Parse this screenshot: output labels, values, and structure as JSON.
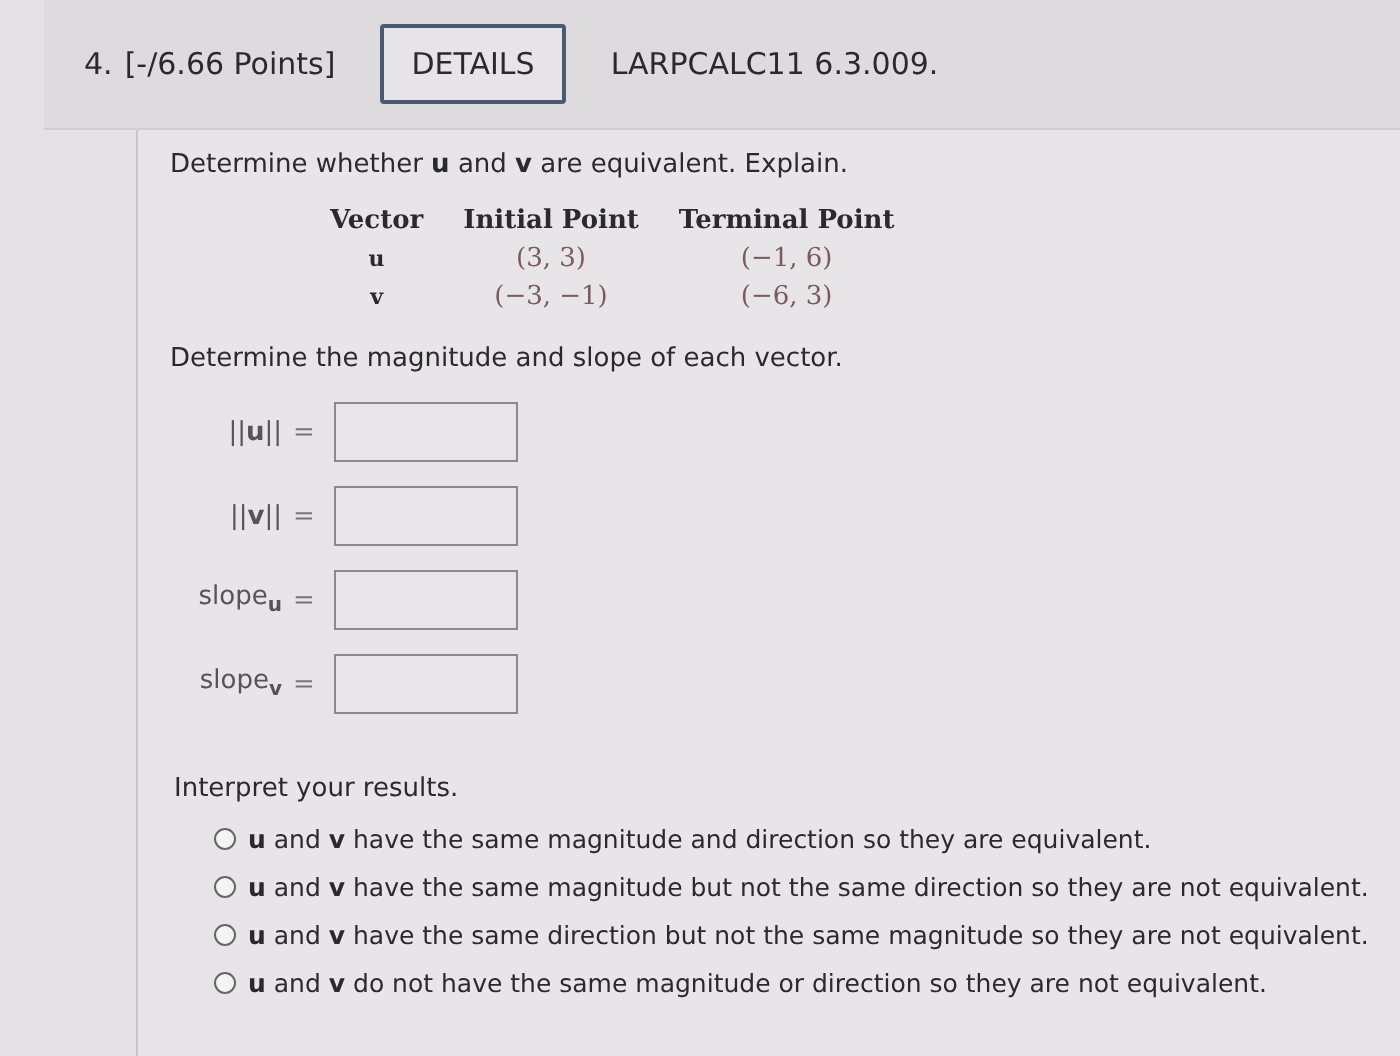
{
  "header": {
    "number": "4.",
    "points": "[-/6.66 Points]",
    "details_button": "DETAILS",
    "code": "LARPCALC11 6.3.009."
  },
  "prompt": "Determine whether **u** and **v** are equivalent. Explain.",
  "table": {
    "columns": [
      "Vector",
      "Initial Point",
      "Terminal Point"
    ],
    "rows": [
      [
        "u",
        "(3, 3)",
        "(−1, 6)"
      ],
      [
        "v",
        "(−3, −1)",
        "(−6, 3)"
      ]
    ]
  },
  "magnitude_prompt": "Determine the magnitude and slope of each vector.",
  "answers": [
    {
      "label": "||**u**||",
      "equals": "="
    },
    {
      "label": "||**v**||",
      "equals": "="
    },
    {
      "label": "slope$_{u}$",
      "equals": "="
    },
    {
      "label": "slope$_{v}$",
      "equals": "="
    }
  ],
  "interpret_prompt": "Interpret your results.",
  "options": [
    {
      "text": "**u** and **v** have the same magnitude and direction so they are equivalent.",
      "selected": false
    },
    {
      "text": "**u** and **v** have the same magnitude but not the same direction so they are not equivalent.",
      "selected": false
    },
    {
      "text": "**u** and **v** have the same direction but not the same magnitude so they are not equivalent.",
      "selected": false
    },
    {
      "text": "**u** and **v** do not have the same magnitude or direction so they are not equivalent.",
      "selected": false
    }
  ]
}
